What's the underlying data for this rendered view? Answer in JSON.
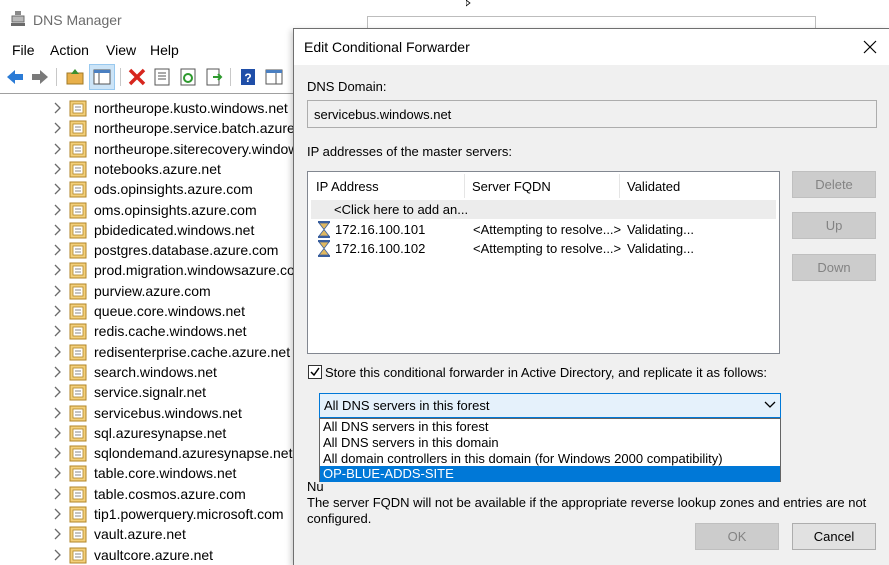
{
  "app": {
    "title": "DNS Manager",
    "icon": "dns-server-icon"
  },
  "menubar": {
    "items": [
      "File",
      "Action",
      "View",
      "Help"
    ]
  },
  "toolbar": {
    "icons": [
      "back-arrow-icon",
      "forward-arrow-icon",
      "up-folder-icon",
      "show-hide-tree-icon",
      "delete-icon",
      "properties-icon",
      "refresh-icon",
      "export-icon",
      "help-icon",
      "show-action-pane-icon"
    ]
  },
  "tree": {
    "zones": [
      "northeurope.kusto.windows.net",
      "northeurope.service.batch.azure.com",
      "northeurope.siterecovery.windowsazure.com",
      "notebooks.azure.net",
      "ods.opinsights.azure.com",
      "oms.opinsights.azure.com",
      "pbidedicated.windows.net",
      "postgres.database.azure.com",
      "prod.migration.windowsazure.com",
      "purview.azure.com",
      "queue.core.windows.net",
      "redis.cache.windows.net",
      "redisenterprise.cache.azure.net",
      "search.windows.net",
      "service.signalr.net",
      "servicebus.windows.net",
      "sql.azuresynapse.net",
      "sqlondemand.azuresynapse.net",
      "table.core.windows.net",
      "table.cosmos.azure.com",
      "tip1.powerquery.microsoft.com",
      "vault.azure.net",
      "vaultcore.azure.net"
    ]
  },
  "dialog": {
    "title": "Edit Conditional Forwarder",
    "dns_domain_label": "DNS Domain:",
    "dns_domain_value": "servicebus.windows.net",
    "master_servers_label": "IP addresses of the master servers:",
    "columns": [
      "IP Address",
      "Server FQDN",
      "Validated"
    ],
    "add_row_text": "<Click here to add an...",
    "servers": [
      {
        "ip": "172.16.100.101",
        "fqdn": "<Attempting to resolve...>",
        "validated": "Validating..."
      },
      {
        "ip": "172.16.100.102",
        "fqdn": "<Attempting to resolve...>",
        "validated": "Validating..."
      }
    ],
    "buttons": {
      "delete": "Delete",
      "up": "Up",
      "down": "Down",
      "ok": "OK",
      "cancel": "Cancel"
    },
    "store_ad_label": "Store this conditional forwarder in Active Directory, and replicate it as follows:",
    "store_ad_checked": true,
    "replication_selected": "All DNS servers in this forest",
    "replication_options": [
      "All DNS servers in this forest",
      "All DNS servers in this domain",
      "All domain controllers in this domain (for Windows 2000 compatibility)",
      "OP-BLUE-ADDS-SITE"
    ],
    "highlighted_option_index": 3,
    "note_prefix": "Nu",
    "note_text": "The server FQDN will not be available if the appropriate reverse lookup zones and entries are not configured."
  },
  "colors": {
    "accent": "#0078d7",
    "zone_folder": "#e8b04a",
    "dialog_bg": "#f0f0f0"
  }
}
